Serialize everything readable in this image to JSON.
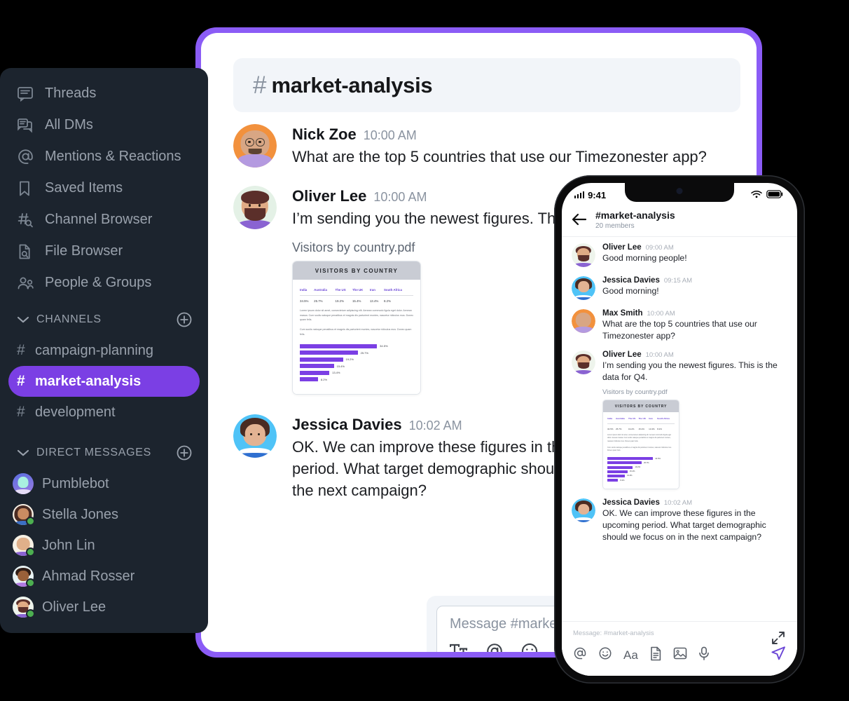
{
  "background_color": "#000000",
  "accent_color": "#7b3fe4",
  "frame_color": "#8b5cf6",
  "sidebar": {
    "nav_items": [
      {
        "label": "Threads",
        "icon": "threads-icon"
      },
      {
        "label": "All DMs",
        "icon": "all-dms-icon"
      },
      {
        "label": "Mentions & Reactions",
        "icon": "at-icon"
      },
      {
        "label": "Saved Items",
        "icon": "bookmark-icon"
      },
      {
        "label": "Channel Browser",
        "icon": "channel-search-icon"
      },
      {
        "label": "File Browser",
        "icon": "file-search-icon"
      },
      {
        "label": "People & Groups",
        "icon": "people-icon"
      }
    ],
    "channels_section": {
      "title": "CHANNELS",
      "add_label": "+"
    },
    "channels": [
      {
        "name": "campaign-planning",
        "active": false
      },
      {
        "name": "market-analysis",
        "active": true
      },
      {
        "name": "development",
        "active": false
      }
    ],
    "dm_section": {
      "title": "DIRECT MESSAGES",
      "add_label": "+"
    },
    "dms": [
      {
        "name": "Pumblebot",
        "online": false,
        "avatar": "bot"
      },
      {
        "name": "Stella Jones",
        "online": true,
        "avatar": "stella"
      },
      {
        "name": "John Lin",
        "online": true,
        "avatar": "john"
      },
      {
        "name": "Ahmad Rosser",
        "online": true,
        "avatar": "ahmad"
      },
      {
        "name": "Oliver Lee",
        "online": true,
        "avatar": "oliver"
      }
    ]
  },
  "desktop": {
    "header": {
      "hash": "#",
      "channel": "market-analysis"
    },
    "messages": [
      {
        "author": "Nick Zoe",
        "time": "10:00 AM",
        "text": "What are the top 5 countries that use our Timezonester app?",
        "avatar": "nick"
      },
      {
        "author": "Oliver Lee",
        "time": "10:00 AM",
        "text": " I’m sending you the newest figures. This is the data for Q4.",
        "avatar": "oliver",
        "attachment_label": "Visitors by country.pdf"
      },
      {
        "author": "Jessica Davies",
        "time": "10:02 AM",
        "text": "OK. We can improve these figures in the upcoming period. What target demographic should we focus on in the next campaign?",
        "avatar": "jessica"
      }
    ],
    "composer": {
      "placeholder": "Message #market-analysis",
      "icons": [
        "format-text-icon",
        "mention-icon",
        "emoji-icon",
        "attachment-icon",
        "microphone-icon",
        "video-icon"
      ]
    }
  },
  "phone": {
    "status_bar": {
      "time": "9:41",
      "signal": "signal-icon",
      "wifi": "wifi-icon",
      "battery": "battery-icon"
    },
    "header": {
      "back": "back-arrow-icon",
      "title": "#market-analysis",
      "subtitle": "20 members"
    },
    "messages": [
      {
        "author": "Oliver Lee",
        "time": "09:00 AM",
        "text": "Good morning people!",
        "avatar": "oliver"
      },
      {
        "author": "Jessica Davies",
        "time": "09:15 AM",
        "text": "Good morning!",
        "avatar": "jessica"
      },
      {
        "author": "Max Smith",
        "time": "10:00 AM",
        "text": "What are the top 5 countries that use our Timezonester app?",
        "avatar": "nick"
      },
      {
        "author": "Oliver Lee",
        "time": "10:00 AM",
        "text": " I’m sending you the newest figures. This is the data for Q4.",
        "avatar": "oliver",
        "attachment_label": "Visitors by country.pdf"
      },
      {
        "author": "Jessica Davies",
        "time": "10:02 AM",
        "text": "OK. We can improve these figures in the upcoming period. What target demographic should we focus on in the next campaign?",
        "avatar": "jessica"
      }
    ],
    "composer": {
      "placeholder": "Message: #market-analysis",
      "expand_icon": "expand-icon",
      "send_icon": "send-icon",
      "icons": [
        "mention-icon",
        "emoji-icon",
        "format-text-icon",
        "document-icon",
        "image-icon",
        "microphone-icon"
      ]
    }
  },
  "chart_data": {
    "type": "bar",
    "title": "VISITORS BY COUNTRY",
    "categories": [
      "India",
      "Australia",
      "The US",
      "The UK",
      "Iran",
      "South Africa"
    ],
    "values": [
      34.5,
      25.7,
      19.2,
      15.4,
      13.4,
      8.2
    ],
    "value_labels": [
      "34.5%",
      "25.7%",
      "19.2%",
      "15.4%",
      "13.4%",
      "8.2%"
    ],
    "xlabel": "",
    "ylabel": "",
    "ylim": [
      0,
      40
    ],
    "grid": false,
    "legend": false,
    "bar_color": "#7b3fe4",
    "paragraphs": [
      "Lorem ipsum dolor sit amet, consectetuer adipiscing elit. Aenean commodo ligula eget dolor. Aenean massa. Cum sociis natoque penatibus et magnis dis parturient montes, nascetur ridiculus mus. Donec quam felis.",
      "Cum sociis natoque penatibus et magnis dis parturient montes, nascetur ridiculus mus. Donec quam felis."
    ]
  }
}
